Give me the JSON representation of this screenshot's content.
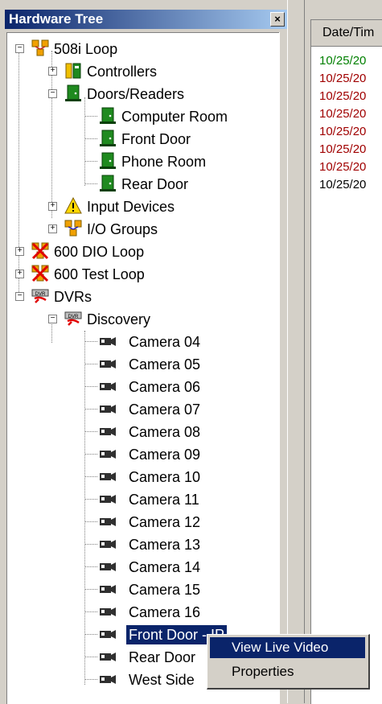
{
  "panel": {
    "title": "Hardware Tree",
    "close_glyph": "×"
  },
  "log": {
    "column_header": "Date/Tim",
    "rows": [
      {
        "text": "10/25/20",
        "color": "#008000"
      },
      {
        "text": "10/25/20",
        "color": "#a00000"
      },
      {
        "text": "10/25/20",
        "color": "#a00000"
      },
      {
        "text": "10/25/20",
        "color": "#a00000"
      },
      {
        "text": "10/25/20",
        "color": "#a00000"
      },
      {
        "text": "10/25/20",
        "color": "#a00000"
      },
      {
        "text": "10/25/20",
        "color": "#a00000"
      },
      {
        "text": "10/25/20",
        "color": "#000000"
      }
    ]
  },
  "tree": {
    "loop508": "508i Loop",
    "controllers": "Controllers",
    "doors_readers": "Doors/Readers",
    "computer_room": "Computer Room",
    "front_door": "Front Door",
    "phone_room": "Phone Room",
    "rear_door": "Rear Door",
    "input_devices": "Input Devices",
    "io_groups": "I/O Groups",
    "dio600": "600 DIO Loop",
    "test600": "600 Test Loop",
    "dvrs": "DVRs",
    "discovery": "Discovery",
    "dvr_badge": "DVR",
    "cameras": [
      "Camera 04",
      "Camera 05",
      "Camera 06",
      "Camera 07",
      "Camera 08",
      "Camera 09",
      "Camera 10",
      "Camera 11",
      "Camera 12",
      "Camera 13",
      "Camera 14",
      "Camera 15",
      "Camera 16"
    ],
    "front_door_cam": "Front Door - IP",
    "rear_door_cam": "Rear Door",
    "west_side_cam": "West Side",
    "expand_plus": "+",
    "expand_minus": "−"
  },
  "context_menu": {
    "items": [
      {
        "label": "View Live Video",
        "active": true
      },
      {
        "label": "Properties",
        "active": false
      }
    ]
  },
  "colors": {
    "selection": "#0a246a",
    "title_bar": "#0a246a",
    "door_green": "#1f8a1f",
    "loop_orange": "#f0a000"
  }
}
